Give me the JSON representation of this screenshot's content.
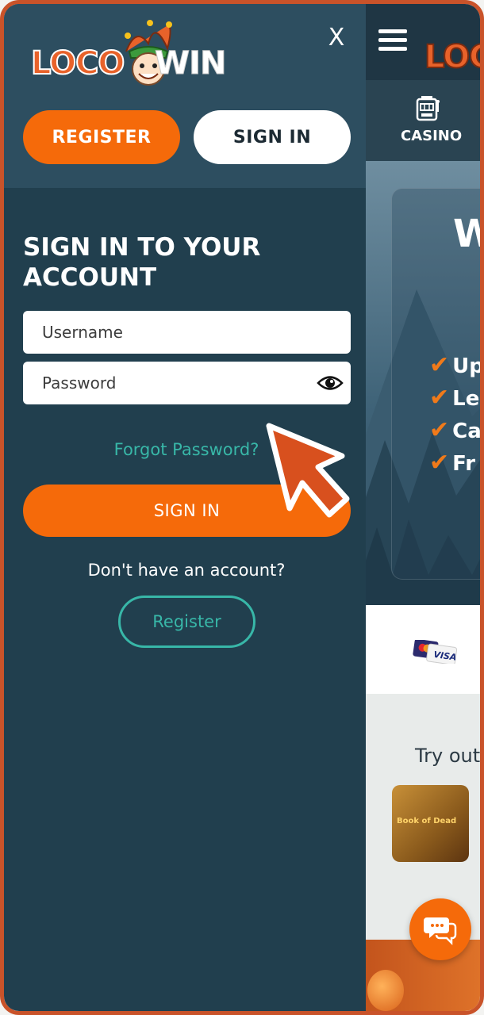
{
  "header": {
    "logo_left": "LOCO",
    "logo_right": "WIN",
    "close_label": "X",
    "register_label": "REGISTER",
    "signin_label": "SIGN IN"
  },
  "form": {
    "title_line1": "SIGN IN TO YOUR",
    "title_line2": "ACCOUNT",
    "username_placeholder": "Username",
    "password_placeholder": "Password",
    "forgot_label": "Forgot Password?",
    "signin_label": "SIGN IN",
    "no_account_text": "Don't have an account?",
    "register_label": "Register"
  },
  "site": {
    "logo_peek": "LOC",
    "nav_casino": "CASINO",
    "hero_title_peek": "W",
    "perks": [
      "Up",
      "Le",
      "Ca",
      "Fr"
    ],
    "payment_label": "VISA",
    "games_heading_peek": "Try out",
    "game_thumb_text": "Book of Dead"
  },
  "colors": {
    "accent": "#f56a0a",
    "teal": "#38b7a8",
    "drawer_bg": "#213f4e",
    "drawer_header_bg": "#2d4e60",
    "frame_border": "#c9532a"
  },
  "icons": [
    "jester-icon",
    "close-icon",
    "eye-icon",
    "hamburger-icon",
    "slot-machine-icon",
    "checkmark-icon",
    "visa-card-icon",
    "chat-icon",
    "pointer-arrow-icon"
  ]
}
